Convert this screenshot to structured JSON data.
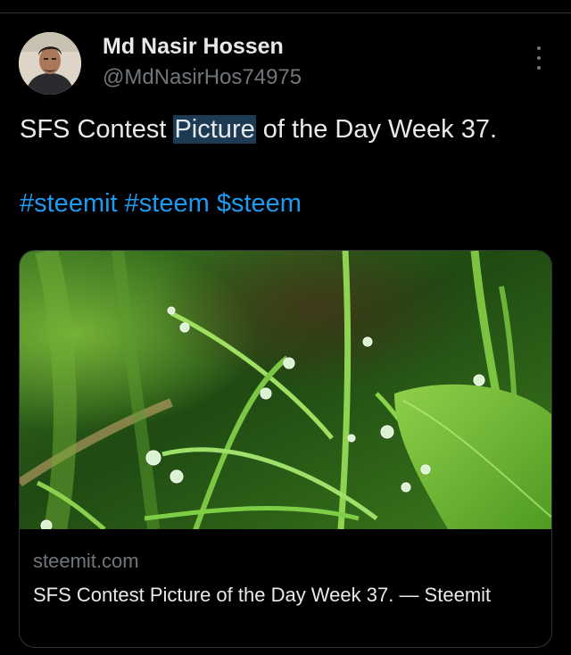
{
  "tweet": {
    "author": {
      "display_name": "Md Nasir Hossen",
      "handle": "@MdNasirHos74975",
      "avatar_icon": "avatar-photo"
    },
    "text_before": "SFS Contest ",
    "text_highlight": "Picture",
    "text_after": " of the Day Week 37.",
    "hashtags": [
      "#steemit",
      "#steem",
      "$steem"
    ],
    "more_icon": "more-vertical-icon"
  },
  "card": {
    "image_icon": "grass-dewdrops-photo",
    "domain": "steemit.com",
    "title": "SFS Contest Picture of the Day Week 37. — Steemit"
  },
  "colors": {
    "background": "#000000",
    "text_primary": "#e7e9ea",
    "text_secondary": "#71767b",
    "link": "#1d9bf0",
    "highlight": "#1d3a55",
    "border": "#2f3336"
  }
}
